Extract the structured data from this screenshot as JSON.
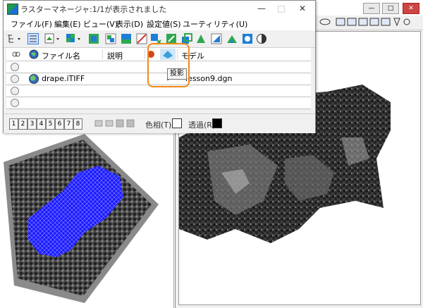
{
  "raster_window": {
    "title": "ラスターマネージャ:1/1が表示されました",
    "controls": {
      "minimize": "—",
      "maximize": "□",
      "close": "✕"
    }
  },
  "menu": [
    {
      "label": "ファイル(F)"
    },
    {
      "label": "編集(E)"
    },
    {
      "label": "ビュー(V)"
    },
    {
      "label": "表示(D)"
    },
    {
      "label": "設定値(S)"
    },
    {
      "label": "ユーティリティ(U)"
    }
  ],
  "columns": {
    "filename": "ファイル名",
    "description": "説明",
    "model": "モデル"
  },
  "rows": [
    {
      "filename": "drape.iTIFF",
      "model": "lesson9.dgn",
      "checked": "✓"
    }
  ],
  "tooltip": "投影",
  "view_buttons": [
    "1",
    "2",
    "3",
    "4",
    "5",
    "6",
    "7",
    "8"
  ],
  "status": {
    "color_label": "色相(T):",
    "transparency_label": "透過(R):"
  },
  "colors": {
    "highlight": "#f08a1a",
    "drape_mesh": "#1a1aff",
    "title_bg": "#ffffff",
    "window_bg": "#f0f0f0"
  }
}
